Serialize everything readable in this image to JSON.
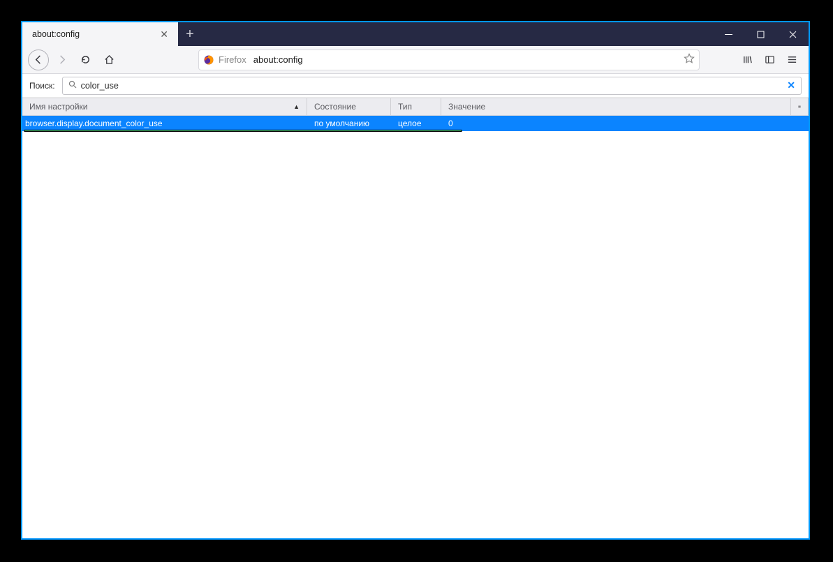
{
  "tab": {
    "title": "about:config"
  },
  "urlbar": {
    "brand": "Firefox",
    "address": "about:config"
  },
  "search": {
    "label": "Поиск:",
    "value": "color_use"
  },
  "columns": {
    "name": "Имя настройки",
    "state": "Состояние",
    "type": "Тип",
    "value": "Значение"
  },
  "row": {
    "name": "browser.display.document_color_use",
    "state": "по умолчанию",
    "type": "целое",
    "value": "0"
  }
}
